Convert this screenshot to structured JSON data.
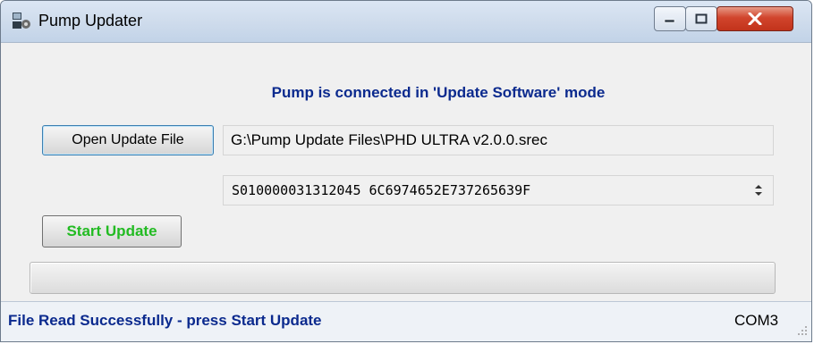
{
  "window": {
    "title": "Pump Updater",
    "icon": "pump-updater-app-icon",
    "controls": {
      "minimize": "minimize-icon",
      "maximize": "maximize-icon",
      "close": "close-icon"
    }
  },
  "main": {
    "status_message": "Pump is connected in 'Update Software' mode",
    "open_button_label": "Open Update File",
    "file_path": "G:\\Pump Update Files\\PHD ULTRA v2.0.0.srec",
    "srec_line": "S010000031312045 6C6974652E737265639F",
    "start_button_label": "Start Update",
    "progress": 0
  },
  "statusbar": {
    "message": "File Read Successfully - press Start Update",
    "port": "COM3"
  },
  "colors": {
    "status_blue": "#0b2a8e",
    "start_green": "#22bb22",
    "close_red": "#c2331b"
  }
}
